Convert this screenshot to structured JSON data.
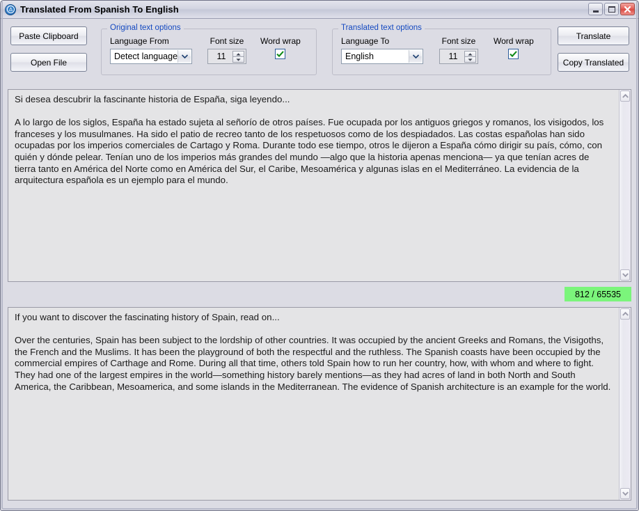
{
  "window": {
    "title": "Translated From Spanish To English",
    "app_icon": "translate-circle-icon",
    "minimize_label": "Minimize",
    "maximize_label": "Maximize",
    "close_label": "Close"
  },
  "toolbar": {
    "paste_clipboard_label": "Paste Clipboard",
    "open_file_label": "Open File",
    "translate_label": "Translate",
    "copy_translated_label": "Copy Translated"
  },
  "original_options": {
    "legend": "Original text options",
    "language_from_label": "Language From",
    "language_from_value": "Detect language",
    "font_size_label": "Font size",
    "font_size_value": "11",
    "word_wrap_label": "Word wrap",
    "word_wrap_checked": "✔"
  },
  "translated_options": {
    "legend": "Translated text options",
    "language_to_label": "Language To",
    "language_to_value": "English",
    "font_size_label": "Font size",
    "font_size_value": "11",
    "word_wrap_label": "Word wrap",
    "word_wrap_checked": "✔"
  },
  "source_pane": {
    "text": "Si desea descubrir la fascinante historia de España, siga leyendo...\n\nA lo largo de los siglos, España ha estado sujeta al señorío de otros países. Fue ocupada por los antiguos griegos y romanos, los visigodos, los franceses y los musulmanes. Ha sido el patio de recreo tanto de los respetuosos como de los despiadados. Las costas españolas han sido ocupadas por los imperios comerciales de Cartago y Roma. Durante todo ese tiempo, otros le dijeron a España cómo dirigir su país, cómo, con quién y dónde pelear. Tenían uno de los imperios más grandes del mundo —algo que la historia apenas menciona— ya que tenían acres de tierra tanto en América del Norte como en América del Sur, el Caribe, Mesoamérica y algunas islas en el Mediterráneo. La evidencia de la arquitectura española es un ejemplo para el mundo."
  },
  "char_counter": {
    "value": "812 / 65535",
    "color": "#7bf57b"
  },
  "translated_pane": {
    "text": "If you want to discover the fascinating history of Spain, read on...\n\nOver the centuries, Spain has been subject to the lordship of other countries. It was occupied by the ancient Greeks and Romans, the Visigoths, the French and the Muslims. It has been the playground of both the respectful and the ruthless. The Spanish coasts have been occupied by the commercial empires of Carthage and Rome. During all that time, others told Spain how to run her country, how, with whom and where to fight. They had one of the largest empires in the world—something history barely mentions—as they had acres of land in both North and South America, the Caribbean, Mesoamerica, and some islands in the Mediterranean. The evidence of Spanish architecture is an example for the world."
  },
  "scrollbars": {
    "up_arrow": "scroll-up-arrow",
    "down_arrow": "scroll-down-arrow"
  }
}
